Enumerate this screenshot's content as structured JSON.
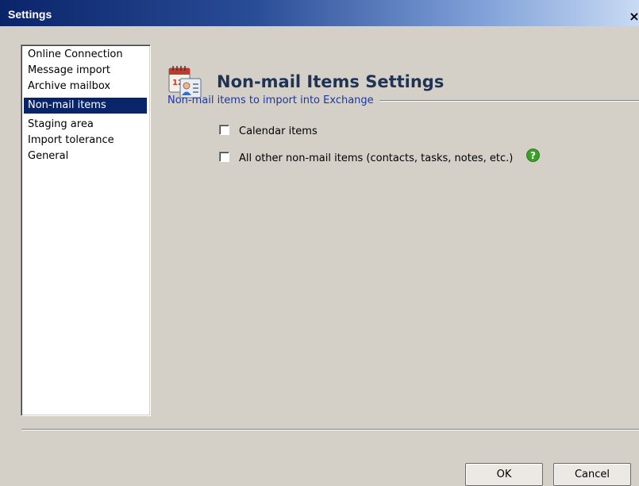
{
  "window": {
    "title": "Settings",
    "close_glyph": "×"
  },
  "sidebar": {
    "items": [
      {
        "label": "Online Connection",
        "selected": false
      },
      {
        "label": "Message import",
        "selected": false
      },
      {
        "label": "Archive mailbox",
        "selected": false
      },
      {
        "label": "Non-mail items",
        "selected": true
      },
      {
        "label": "Staging area",
        "selected": false
      },
      {
        "label": "Import tolerance",
        "selected": false
      },
      {
        "label": "General",
        "selected": false
      }
    ]
  },
  "main": {
    "icon": "calendar-contact-icon",
    "title": "Non-mail Items Settings",
    "group_label": "Non-mail items to import into Exchange",
    "options": [
      {
        "label": "Calendar items",
        "checked": false
      },
      {
        "label": "All other non-mail items (contacts, tasks, notes, etc.)",
        "checked": false,
        "has_help": true
      }
    ],
    "help_icon": "help-icon"
  },
  "footer": {
    "ok_label": "OK",
    "cancel_label": "Cancel"
  },
  "colors": {
    "selection": "#0a246a",
    "group_label": "#1a36a8",
    "title": "#1f3354",
    "help_green": "#3aa02a"
  }
}
